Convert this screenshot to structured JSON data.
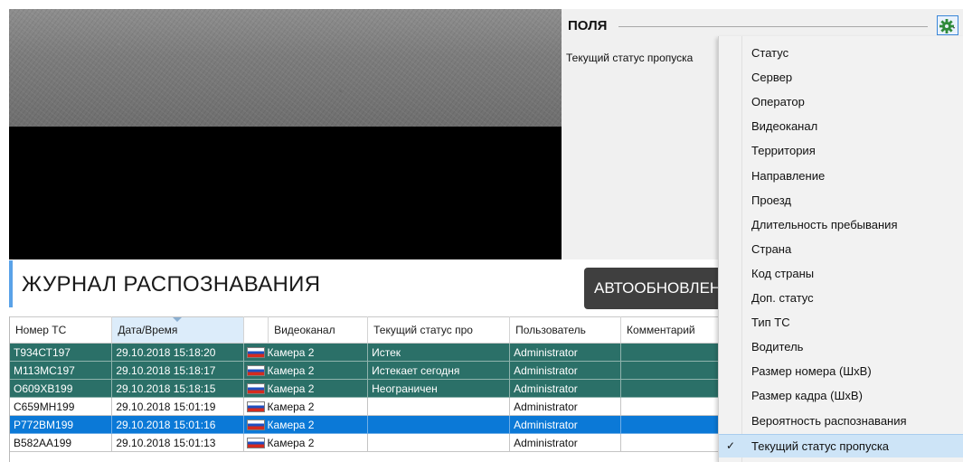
{
  "fields_panel": {
    "title": "ПОЛЯ",
    "item": "Текущий статус пропуска"
  },
  "journal": {
    "title": "ЖУРНАЛ РАСПОЗНАВАНИЯ",
    "autoupdate_label": "АВТООБНОВЛЕНИЕ"
  },
  "table": {
    "columns": [
      "Номер ТС",
      "Дата/Время",
      "",
      "Видеоканал",
      "Текущий статус про",
      "Пользователь",
      "Комментарий"
    ],
    "rows": [
      {
        "plate": "Т934СТ197",
        "datetime": "29.10.2018 15:18:20",
        "channel": "Камера 2",
        "status": "Истек",
        "user": "Administrator",
        "comment": "",
        "style": "teal"
      },
      {
        "plate": "М113МС197",
        "datetime": "29.10.2018 15:18:17",
        "channel": "Камера 2",
        "status": "Истекает сегодня",
        "user": "Administrator",
        "comment": "",
        "style": "teal"
      },
      {
        "plate": "О609ХВ199",
        "datetime": "29.10.2018 15:18:15",
        "channel": "Камера 2",
        "status": "Неограничен",
        "user": "Administrator",
        "comment": "",
        "style": "teal"
      },
      {
        "plate": "С659МН199",
        "datetime": "29.10.2018 15:01:19",
        "channel": "Камера 2",
        "status": "",
        "user": "Administrator",
        "comment": "",
        "style": "white"
      },
      {
        "plate": "Р772ВМ199",
        "datetime": "29.10.2018 15:01:16",
        "channel": "Камера 2",
        "status": "",
        "user": "Administrator",
        "comment": "",
        "style": "blue"
      },
      {
        "plate": "В582АА199",
        "datetime": "29.10.2018 15:01:13",
        "channel": "Камера 2",
        "status": "",
        "user": "Administrator",
        "comment": "",
        "style": "white"
      }
    ]
  },
  "menu": {
    "items": [
      {
        "label": "Статус",
        "checked": false
      },
      {
        "label": "Сервер",
        "checked": false
      },
      {
        "label": "Оператор",
        "checked": false
      },
      {
        "label": "Видеоканал",
        "checked": false
      },
      {
        "label": "Территория",
        "checked": false
      },
      {
        "label": "Направление",
        "checked": false
      },
      {
        "label": "Проезд",
        "checked": false
      },
      {
        "label": "Длительность пребывания",
        "checked": false
      },
      {
        "label": "Страна",
        "checked": false
      },
      {
        "label": "Код страны",
        "checked": false
      },
      {
        "label": "Доп. статус",
        "checked": false
      },
      {
        "label": "Тип ТС",
        "checked": false
      },
      {
        "label": "Водитель",
        "checked": false
      },
      {
        "label": "Размер номера (ШхВ)",
        "checked": false
      },
      {
        "label": "Размер кадра (ШхВ)",
        "checked": false
      },
      {
        "label": "Вероятность распознавания",
        "checked": false
      },
      {
        "label": "Текущий статус пропуска",
        "checked": true
      }
    ],
    "check_glyph": "✓"
  },
  "colors": {
    "row_teal": "#2b7068",
    "row_selected": "#0b79d7",
    "accent": "#5aa2e8",
    "gear": "#2f8a3a"
  },
  "icons": {
    "gear": "gear-icon",
    "flag": "russia-flag-icon",
    "check": "checkmark-icon"
  }
}
